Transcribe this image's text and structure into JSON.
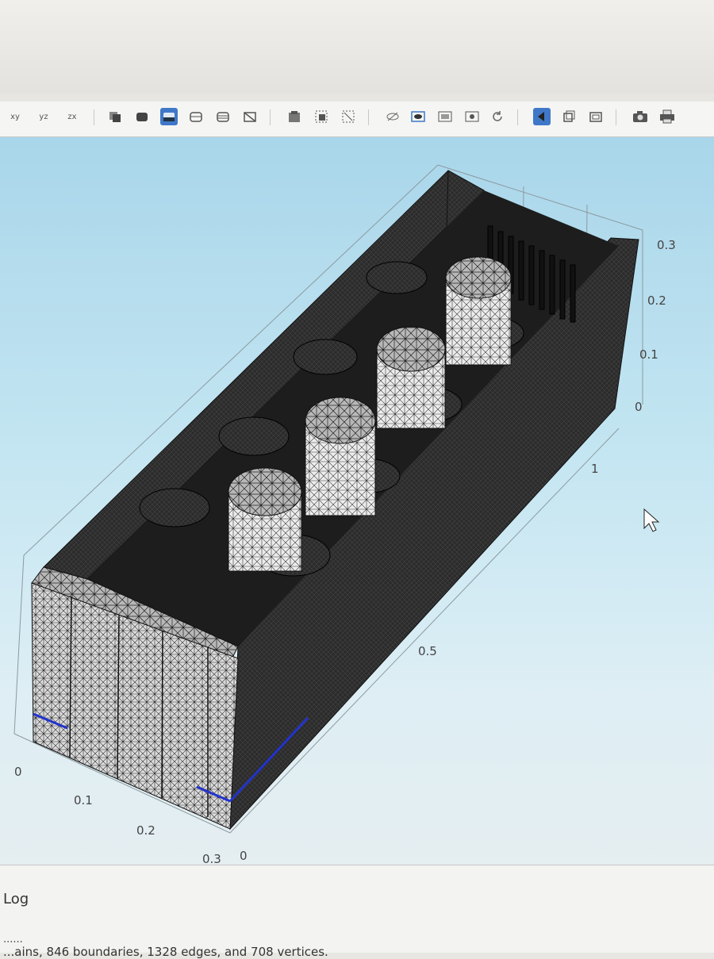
{
  "toolbar": {
    "buttons": [
      {
        "icon": "xy-view-icon",
        "label": "xy"
      },
      {
        "icon": "yz-view-icon",
        "label": "yz"
      },
      {
        "icon": "zx-view-icon",
        "label": "zx"
      },
      {
        "icon": "render-wireframe-icon"
      },
      {
        "icon": "render-solid-icon"
      },
      {
        "icon": "render-mesh-icon",
        "active": true
      },
      {
        "icon": "render-boundary-icon"
      },
      {
        "icon": "render-edges-icon"
      },
      {
        "icon": "hide-mesh-icon"
      },
      {
        "icon": "select-box-icon"
      },
      {
        "icon": "zoom-box-icon"
      },
      {
        "icon": "zoom-extents-icon"
      },
      {
        "icon": "hide-icon"
      },
      {
        "icon": "show-icon"
      },
      {
        "icon": "transparency-icon"
      },
      {
        "icon": "scene-light-icon"
      },
      {
        "icon": "rotate-icon"
      },
      {
        "icon": "select-domain-icon",
        "active": true
      },
      {
        "icon": "select-boundary-icon"
      },
      {
        "icon": "select-edge-icon"
      },
      {
        "icon": "camera-icon"
      },
      {
        "icon": "print-icon"
      }
    ]
  },
  "axes": {
    "z_ticks": [
      "0.3",
      "0.2",
      "0.1",
      "0"
    ],
    "y_ticks": [
      "1",
      "0.5",
      "0"
    ],
    "x_ticks": [
      "0",
      "0.1",
      "0.2",
      "0.3"
    ]
  },
  "log": {
    "title": "Log",
    "separator": "......",
    "message": "...ains, 846 boundaries, 1328 edges, and 708 vertices."
  },
  "colors": {
    "accent": "#3f78c8",
    "mesh_dark": "#1a1a1a",
    "mesh_light": "#d8d8d8",
    "axis_highlight": "#2233cc"
  }
}
